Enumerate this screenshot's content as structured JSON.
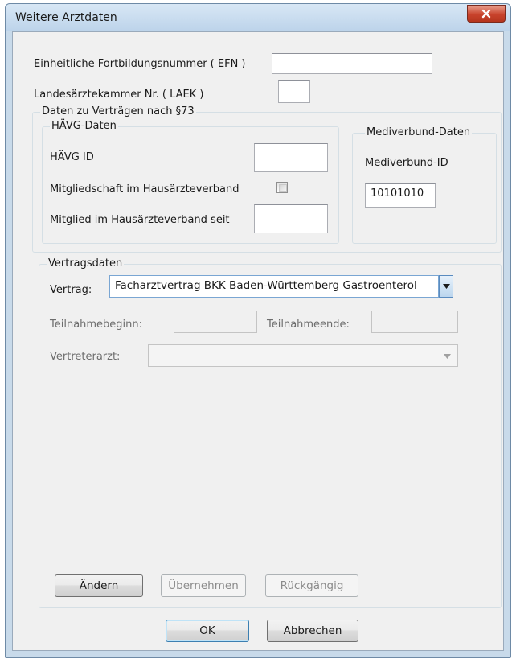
{
  "window": {
    "title": "Weitere Arztdaten",
    "close_icon": "close-x-icon"
  },
  "fields": {
    "efn_label": "Einheitliche Fortbildungsnummer ( EFN )",
    "efn_value": "",
    "laek_label": "Landesärztekammer Nr. ( LAEK )",
    "laek_value": ""
  },
  "vertraege_group": {
    "title": "Daten zu Verträgen nach §73"
  },
  "haevg": {
    "title": "HÄVG-Daten",
    "id_label": "HÄVG ID",
    "id_value": "",
    "mitgliedschaft_label": "Mitgliedschaft im Hausärzteverband",
    "mitgliedschaft_checked": false,
    "mitglied_seit_label": "Mitglied im Hausärzteverband seit",
    "mitglied_seit_value": ""
  },
  "mediverbund": {
    "title": "Mediverbund-Daten",
    "id_label": "Mediverbund-ID",
    "id_value": "10101010"
  },
  "vertragsdaten": {
    "title": "Vertragsdaten",
    "vertrag_label": "Vertrag:",
    "vertrag_value": "Facharztvertrag BKK Baden-Württemberg Gastroenterol",
    "teilnahmebeginn_label": "Teilnahmebeginn:",
    "teilnahmebeginn_value": "",
    "teilnahmeende_label": "Teilnahmeende:",
    "teilnahmeende_value": "",
    "vertreterarzt_label": "Vertreterarzt:",
    "vertreterarzt_value": ""
  },
  "actions": {
    "aendern": "Ändern",
    "uebernehmen": "Übernehmen",
    "rueckgaengig": "Rückgängig"
  },
  "footer": {
    "ok": "OK",
    "abbrechen": "Abbrechen"
  },
  "colors": {
    "titlebar": "#bcd3ea",
    "close_button": "#c8432c",
    "client_bg": "#f0f0f0",
    "combo_border": "#7aa6d3"
  }
}
